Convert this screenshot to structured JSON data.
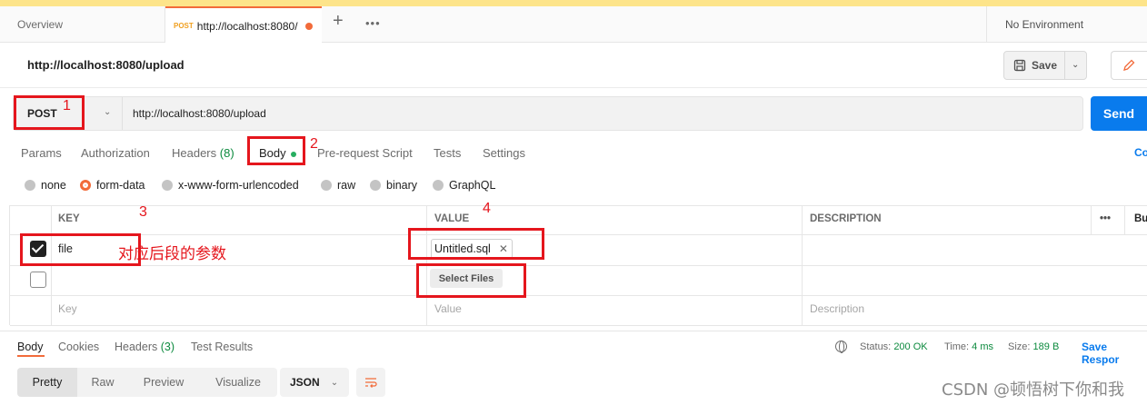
{
  "tabs": {
    "overview": "Overview",
    "active_method": "POST",
    "active_url": "http://localhost:8080/",
    "plus": "+",
    "more": "•••"
  },
  "environment": "No Environment",
  "request": {
    "title": "http://localhost:8080/upload",
    "save_label": "Save",
    "method": "POST",
    "url": "http://localhost:8080/upload",
    "send_label": "Send"
  },
  "request_tabs": {
    "params": "Params",
    "authorization": "Authorization",
    "headers": "Headers",
    "headers_count": "(8)",
    "body": "Body",
    "prerequest": "Pre-request Script",
    "tests": "Tests",
    "settings": "Settings",
    "cookies": "Co"
  },
  "body_modes": [
    "none",
    "form-data",
    "x-www-form-urlencoded",
    "raw",
    "binary",
    "GraphQL"
  ],
  "selected_body_mode": "form-data",
  "table": {
    "col_key": "KEY",
    "col_value": "VALUE",
    "col_description": "DESCRIPTION",
    "more": "•••",
    "bulk": "Bu",
    "row1_key": "file",
    "row1_value": "Untitled.sql",
    "select_files": "Select Files",
    "placeholder_key": "Key",
    "placeholder_value": "Value",
    "placeholder_description": "Description"
  },
  "annotations": {
    "n1": "1",
    "n2": "2",
    "n3": "3",
    "n4": "4",
    "note": "对应后段的参数",
    "color": "#e5161d"
  },
  "response": {
    "body": "Body",
    "cookies": "Cookies",
    "headers": "Headers",
    "headers_count": "(3)",
    "test_results": "Test Results",
    "status_label": "Status:",
    "status_value": "200 OK",
    "time_label": "Time:",
    "time_value": "4 ms",
    "size_label": "Size:",
    "size_value": "189 B",
    "save_response": "Save Respor",
    "view_pretty": "Pretty",
    "view_raw": "Raw",
    "view_preview": "Preview",
    "view_visualize": "Visualize",
    "format": "JSON"
  },
  "watermark": "CSDN @顿悟树下你和我",
  "colors": {
    "accent": "#f26b3a",
    "send": "#097bed",
    "success": "#0c8a3e"
  }
}
